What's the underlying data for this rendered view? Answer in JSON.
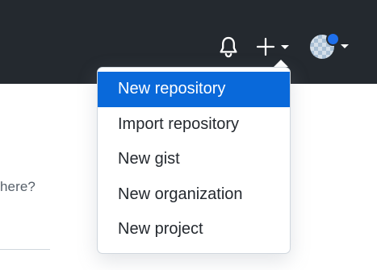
{
  "header": {
    "notifications_icon": "bell-icon",
    "create_icon": "plus-icon",
    "create_caret_icon": "caret-down-icon",
    "avatar_caret_icon": "caret-down-icon",
    "avatar_status_color": "#1f6feb"
  },
  "page": {
    "partial_text": "here?"
  },
  "create_menu": {
    "items": [
      {
        "label": "New repository",
        "active": true
      },
      {
        "label": "Import repository",
        "active": false
      },
      {
        "label": "New gist",
        "active": false
      },
      {
        "label": "New organization",
        "active": false
      },
      {
        "label": "New project",
        "active": false
      }
    ]
  },
  "colors": {
    "header_background": "#24292f",
    "active_item_background": "#0969da",
    "text": "#24292f"
  }
}
